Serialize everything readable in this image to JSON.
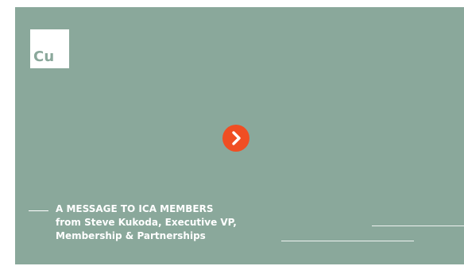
{
  "logo": {
    "text": "Cu"
  },
  "play_button": {
    "icon": "chevron-right-icon",
    "color": "#f04e23"
  },
  "caption": {
    "line1": "A MESSAGE TO ICA MEMBERS",
    "line2": "from Steve Kukoda, Executive VP,",
    "line3": "Membership & Partnerships"
  },
  "colors": {
    "card_background": "#8aa89b",
    "text": "#ffffff",
    "accent": "#f04e23"
  }
}
